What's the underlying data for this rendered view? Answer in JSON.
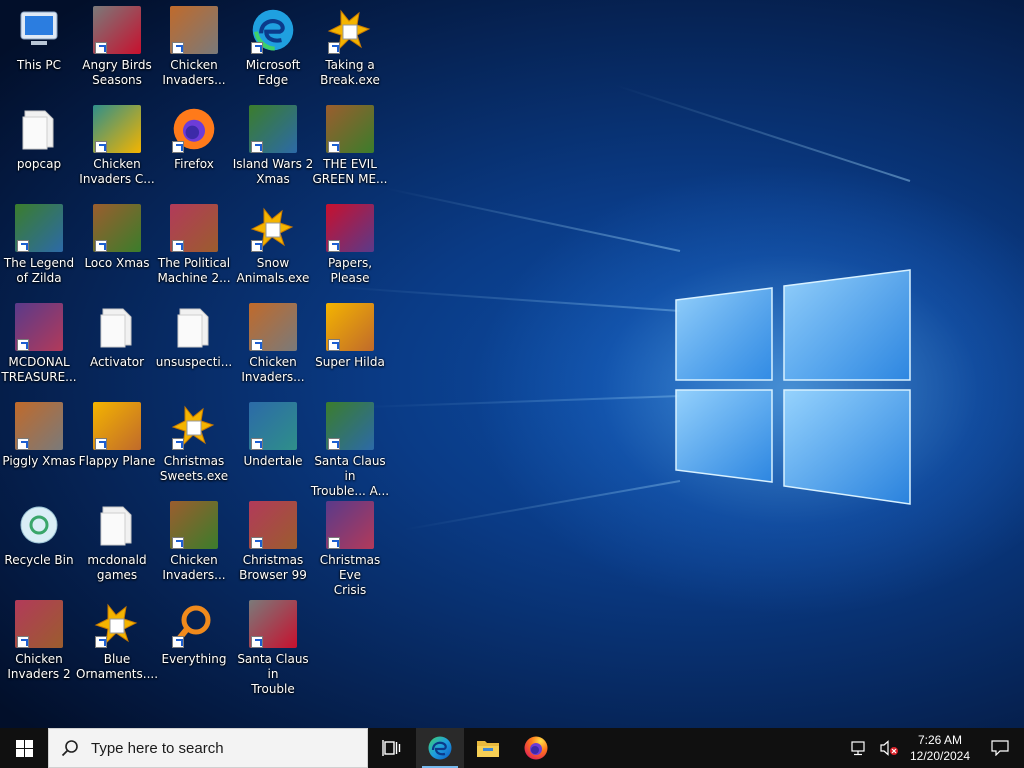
{
  "desktop": {
    "icons": [
      {
        "label": "This PC",
        "icon": "computer-icon"
      },
      {
        "label": "popcap",
        "icon": "folder-icon"
      },
      {
        "label": "The Legend\nof Zilda",
        "icon": "game-icon"
      },
      {
        "label": "MCDONAL\nTREASURE...",
        "icon": "game-icon"
      },
      {
        "label": "Piggly Xmas",
        "icon": "game-icon"
      },
      {
        "label": "Recycle Bin",
        "icon": "recycle-bin-icon"
      },
      {
        "label": "Chicken\nInvaders 2",
        "icon": "game-icon"
      },
      {
        "label": "Angry Birds\nSeasons",
        "icon": "game-icon"
      },
      {
        "label": "Chicken\nInvaders C...",
        "icon": "game-icon"
      },
      {
        "label": "Loco Xmas",
        "icon": "game-icon"
      },
      {
        "label": "Activator",
        "icon": "folder-icon"
      },
      {
        "label": "Flappy Plane",
        "icon": "game-icon"
      },
      {
        "label": "mcdonald\ngames",
        "icon": "folder-icon"
      },
      {
        "label": "Blue\nOrnaments....",
        "icon": "executable-icon"
      },
      {
        "label": "Chicken\nInvaders...",
        "icon": "game-icon"
      },
      {
        "label": "Firefox",
        "icon": "firefox-icon"
      },
      {
        "label": "The Political\nMachine 2...",
        "icon": "game-icon"
      },
      {
        "label": "unsuspecti...",
        "icon": "folder-icon"
      },
      {
        "label": "Christmas\nSweets.exe",
        "icon": "executable-icon"
      },
      {
        "label": "Chicken\nInvaders...",
        "icon": "game-icon"
      },
      {
        "label": "Everything",
        "icon": "everything-search-icon"
      },
      {
        "label": "Microsoft\nEdge",
        "icon": "edge-icon"
      },
      {
        "label": "Island Wars 2\nXmas",
        "icon": "game-icon"
      },
      {
        "label": "Snow\nAnimals.exe",
        "icon": "executable-icon"
      },
      {
        "label": "Chicken\nInvaders...",
        "icon": "game-icon"
      },
      {
        "label": "Undertale",
        "icon": "game-icon"
      },
      {
        "label": "Christmas\nBrowser 99",
        "icon": "game-icon"
      },
      {
        "label": "Santa Claus in\nTrouble",
        "icon": "game-icon"
      },
      {
        "label": "Taking a\nBreak.exe",
        "icon": "executable-icon"
      },
      {
        "label": "THE EVIL\nGREEN ME...",
        "icon": "game-icon"
      },
      {
        "label": "Papers, Please",
        "icon": "game-icon"
      },
      {
        "label": "Super Hilda",
        "icon": "game-icon"
      },
      {
        "label": "Santa Claus in\nTrouble... A...",
        "icon": "game-icon"
      },
      {
        "label": "Christmas Eve\nCrisis",
        "icon": "game-icon"
      }
    ]
  },
  "taskbar": {
    "search_placeholder": "Type here to search",
    "pinned": [
      "task-view-icon",
      "edge-icon",
      "file-explorer-icon",
      "firefox-icon"
    ],
    "clock_time": "7:26 AM",
    "clock_date": "12/20/2024"
  },
  "colors": {
    "taskbar_bg": "#101010",
    "accent": "#76b9ed"
  }
}
